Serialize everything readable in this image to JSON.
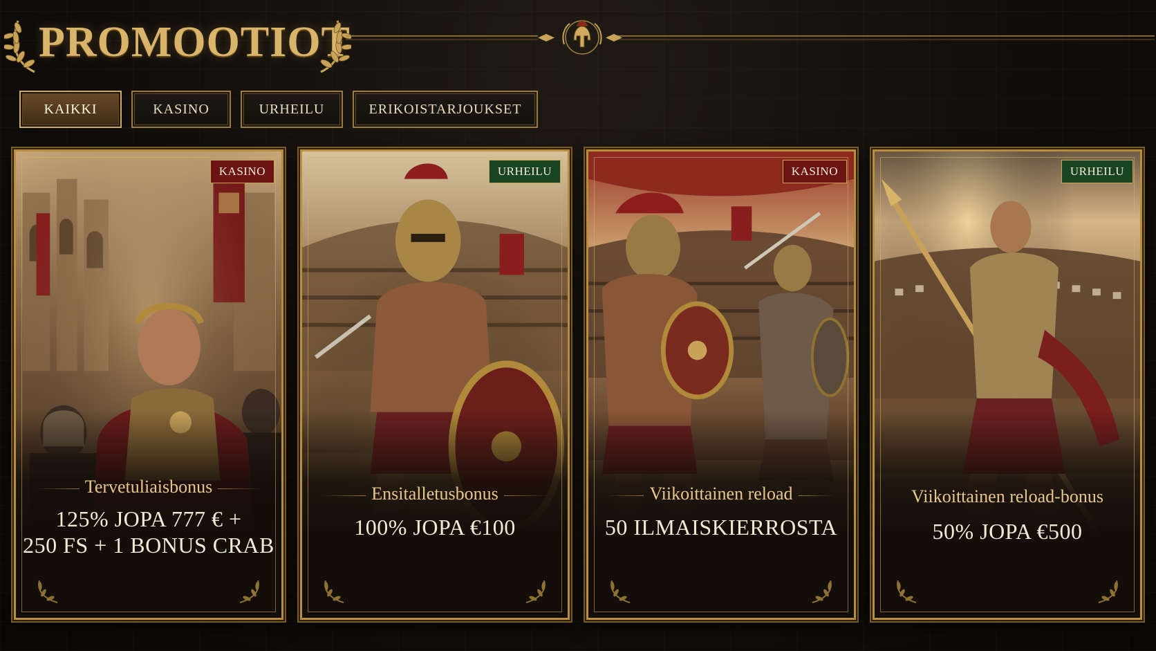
{
  "page": {
    "title": "PROMOOTIOT"
  },
  "icons": {
    "left_laurel": "laurel-left-icon",
    "right_laurel": "laurel-right-icon",
    "emblem": "spartan-helmet-icon"
  },
  "tabs": [
    {
      "label": "KAIKKI",
      "active": true
    },
    {
      "label": "KASINO",
      "active": false
    },
    {
      "label": "URHEILU",
      "active": false
    },
    {
      "label": "ERIKOISTARJOUKSET",
      "active": false
    }
  ],
  "cards": [
    {
      "badge": "KASINO",
      "title": "Tervetuliaisbonus",
      "offer_line1": "125% JOPA 777 € +",
      "offer_line2": "250 FS + 1 BONUS CRAB",
      "art": "emperor-with-guards"
    },
    {
      "badge": "URHEILU",
      "title": "Ensitalletusbonus",
      "offer_line1": "100% JOPA €100",
      "offer_line2": "",
      "art": "charging-gladiator"
    },
    {
      "badge": "KASINO",
      "title": "Viikoittainen reload",
      "offer_line1": "50 ILMAISKIERROSTA",
      "offer_line2": "",
      "art": "gladiators-fighting"
    },
    {
      "badge": "URHEILU",
      "title": "Viikoittainen reload-bonus",
      "offer_line1": "50% JOPA €500",
      "offer_line2": "",
      "art": "spear-gladiator"
    }
  ],
  "colors": {
    "gold": "#d8b56b",
    "kasino_badge": "#6c1414",
    "urheilu_badge": "#18451f",
    "background": "#110e0b"
  }
}
